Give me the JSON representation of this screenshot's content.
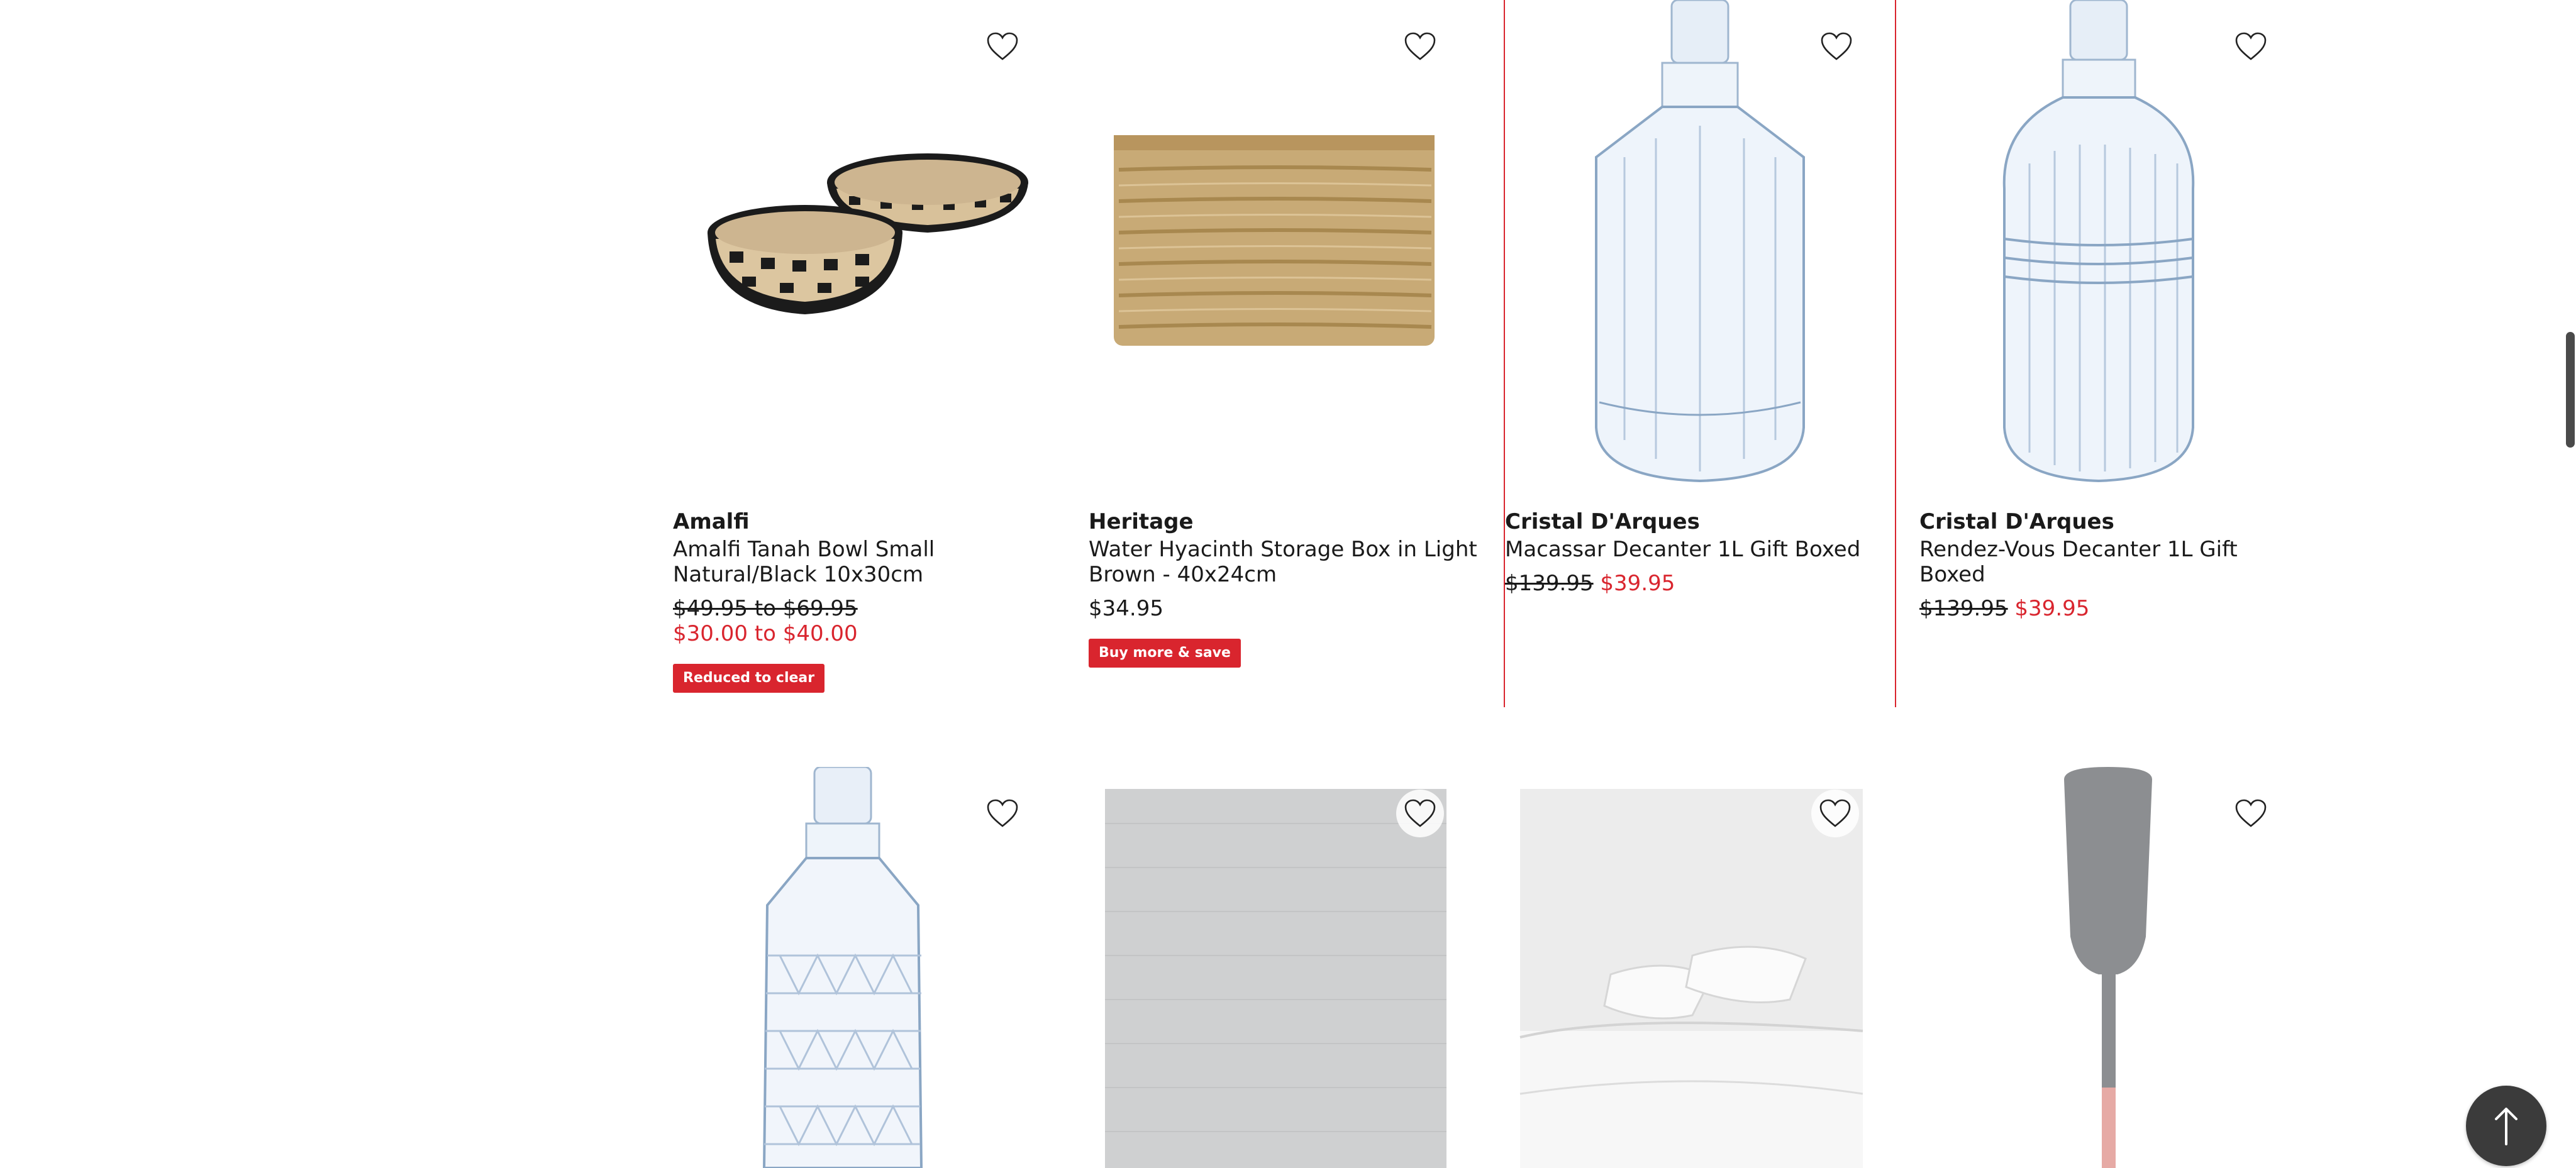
{
  "colors": {
    "accent_red": "#d9252e",
    "text": "#1a1a1a",
    "button_dark": "#3b3b3b"
  },
  "products_row1": [
    {
      "brand": "Amalfi",
      "title": "Amalfi Tanah Bowl Small Natural/Black 10x30cm",
      "price_was": "$49.95 to $69.95",
      "price_now": "$30.00 to $40.00",
      "badge": "Reduced to clear",
      "image_icon": "woven-bowls-image"
    },
    {
      "brand": "Heritage",
      "title": "Water Hyacinth Storage Box in Light Brown - 40x24cm",
      "price_regular": "$34.95",
      "badge": "Buy more & save",
      "image_icon": "woven-storage-box-image"
    },
    {
      "brand": "Cristal D'Arques",
      "title": "Macassar Decanter 1L Gift Boxed",
      "price_was": "$139.95",
      "price_now": "$39.95",
      "image_icon": "glass-decanter-image"
    },
    {
      "brand": "Cristal D'Arques",
      "title": "Rendez-Vous Decanter 1L Gift Boxed",
      "price_was": "$139.95",
      "price_now": "$39.95",
      "image_icon": "glass-decanter-image"
    }
  ],
  "products_row2": [
    {
      "image_icon": "cut-glass-decanter-image"
    },
    {
      "image_icon": "grey-rug-image"
    },
    {
      "image_icon": "white-bed-linen-image"
    },
    {
      "image_icon": "silicone-spatula-image"
    }
  ],
  "icons": {
    "wishlist": "heart-icon",
    "back_to_top": "arrow-up-icon"
  }
}
